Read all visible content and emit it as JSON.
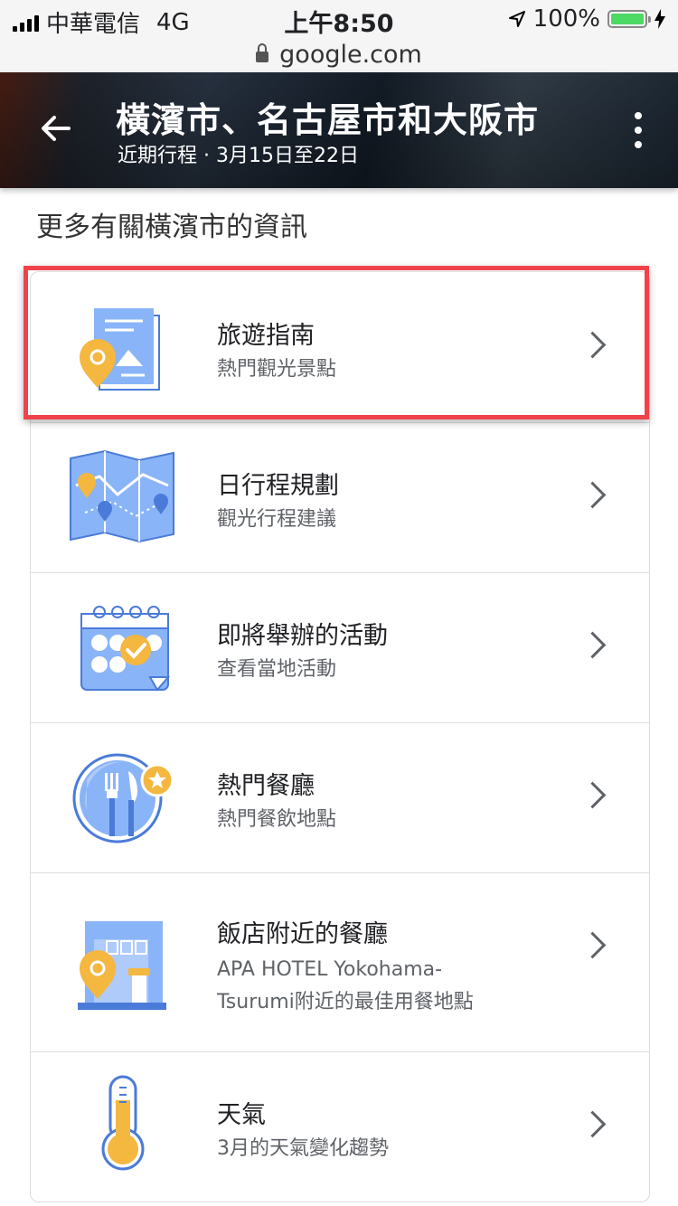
{
  "status_bar": {
    "carrier": "中華電信",
    "network": "4G",
    "time": "上午8:50",
    "battery": "100%",
    "battery_level": 1.0
  },
  "browser": {
    "url": "google.com"
  },
  "header": {
    "title": "橫濱市、名古屋市和大阪市",
    "subtitle": "近期行程 · 3月15日至22日"
  },
  "section_title": "更多有關橫濱市的資訊",
  "items": [
    {
      "title": "旅遊指南",
      "subtitle": "熱門觀光景點",
      "icon": "travel-guide-icon"
    },
    {
      "title": "日行程規劃",
      "subtitle": "觀光行程建議",
      "icon": "map-icon"
    },
    {
      "title": "即將舉辦的活動",
      "subtitle": "查看當地活動",
      "icon": "calendar-icon"
    },
    {
      "title": "熱門餐廳",
      "subtitle": "熱門餐飲地點",
      "icon": "restaurant-icon"
    },
    {
      "title": "飯店附近的餐廳",
      "subtitle": "APA HOTEL Yokohama-Tsurumi附近的最佳用餐地點",
      "icon": "hotel-icon"
    },
    {
      "title": "天氣",
      "subtitle": "3月的天氣變化趨勢",
      "icon": "thermometer-icon"
    }
  ],
  "colors": {
    "accent_blue": "#8ab4f8",
    "dark_blue": "#4a7bd8",
    "pin_yellow": "#f4b740",
    "highlight_red": "#ef4349"
  }
}
